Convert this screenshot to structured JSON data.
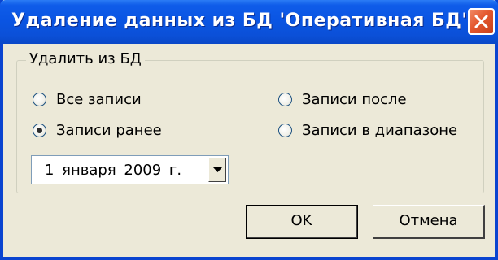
{
  "window": {
    "title": "Удаление данных из БД 'Оперативная БД'"
  },
  "group": {
    "label": "Удалить из БД"
  },
  "options": [
    {
      "label": "Все записи",
      "checked": false
    },
    {
      "label": "Записи ранее",
      "checked": true
    },
    {
      "label": "Записи после",
      "checked": false
    },
    {
      "label": "Записи в диапазоне",
      "checked": false
    }
  ],
  "date": {
    "value": "1  января  2009 г."
  },
  "buttons": {
    "ok": "OK",
    "cancel": "Отмена"
  },
  "icons": {
    "close": "close-icon",
    "dropdown": "chevron-down-icon"
  }
}
